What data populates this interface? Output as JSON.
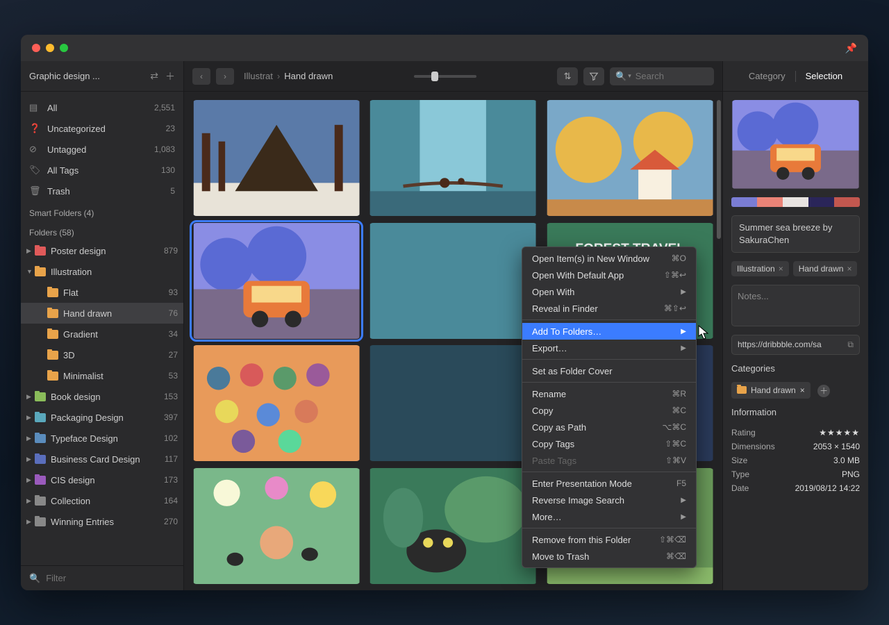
{
  "library_name": "Graphic design ...",
  "sidebar": {
    "all": {
      "label": "All",
      "count": "2,551"
    },
    "uncategorized": {
      "label": "Uncategorized",
      "count": "23"
    },
    "untagged": {
      "label": "Untagged",
      "count": "1,083"
    },
    "alltags": {
      "label": "All Tags",
      "count": "130"
    },
    "trash": {
      "label": "Trash",
      "count": "5"
    },
    "smart_label": "Smart Folders (4)",
    "folders_label": "Folders (58)",
    "folders": [
      {
        "label": "Poster design",
        "count": "879",
        "color": "#e05a5a",
        "depth": 0,
        "disc": "▶"
      },
      {
        "label": "Illustration",
        "count": "",
        "color": "#e8a34a",
        "depth": 0,
        "disc": "▼"
      },
      {
        "label": "Flat",
        "count": "93",
        "color": "#e8a34a",
        "depth": 1,
        "disc": ""
      },
      {
        "label": "Hand drawn",
        "count": "76",
        "color": "#e8a34a",
        "depth": 1,
        "disc": "",
        "active": true
      },
      {
        "label": "Gradient",
        "count": "34",
        "color": "#e8a34a",
        "depth": 1,
        "disc": ""
      },
      {
        "label": "3D",
        "count": "27",
        "color": "#e8a34a",
        "depth": 1,
        "disc": ""
      },
      {
        "label": "Minimalist",
        "count": "53",
        "color": "#e8a34a",
        "depth": 1,
        "disc": ""
      },
      {
        "label": "Book design",
        "count": "153",
        "color": "#8abc5a",
        "depth": 0,
        "disc": "▶"
      },
      {
        "label": "Packaging Design",
        "count": "397",
        "color": "#5aa8bc",
        "depth": 0,
        "disc": "▶"
      },
      {
        "label": "Typeface Design",
        "count": "102",
        "color": "#5a8cbc",
        "depth": 0,
        "disc": "▶"
      },
      {
        "label": "Business Card Design",
        "count": "117",
        "color": "#5a6ebc",
        "depth": 0,
        "disc": "▶"
      },
      {
        "label": "CIS design",
        "count": "173",
        "color": "#9a5abc",
        "depth": 0,
        "disc": "▶"
      },
      {
        "label": "Collection",
        "count": "164",
        "color": "#888",
        "depth": 0,
        "disc": "▶"
      },
      {
        "label": "Winning Entries",
        "count": "270",
        "color": "#888",
        "depth": 0,
        "disc": "▶"
      }
    ]
  },
  "filter_placeholder": "Filter",
  "breadcrumb": {
    "a": "Illustrat",
    "b": "Hand drawn"
  },
  "search_placeholder": "Search",
  "context_menu": [
    {
      "label": "Open Item(s) in New Window",
      "shortcut": "⌘O"
    },
    {
      "label": "Open With Default App",
      "shortcut": "⇧⌘↩"
    },
    {
      "label": "Open With",
      "sub": true
    },
    {
      "label": "Reveal in Finder",
      "shortcut": "⌘⇧↩"
    },
    {
      "sep": true
    },
    {
      "label": "Add To Folders…",
      "sub": true,
      "highlight": true
    },
    {
      "label": "Export…",
      "sub": true
    },
    {
      "sep": true
    },
    {
      "label": "Set as Folder Cover"
    },
    {
      "sep": true
    },
    {
      "label": "Rename",
      "shortcut": "⌘R"
    },
    {
      "label": "Copy",
      "shortcut": "⌘C"
    },
    {
      "label": "Copy as Path",
      "shortcut": "⌥⌘C"
    },
    {
      "label": "Copy Tags",
      "shortcut": "⇧⌘C"
    },
    {
      "label": "Paste Tags",
      "shortcut": "⇧⌘V",
      "disabled": true
    },
    {
      "sep": true
    },
    {
      "label": "Enter Presentation Mode",
      "shortcut": "F5"
    },
    {
      "label": "Reverse Image Search",
      "sub": true
    },
    {
      "label": "More…",
      "sub": true
    },
    {
      "sep": true
    },
    {
      "label": "Remove from this Folder",
      "shortcut": "⇧⌘⌫"
    },
    {
      "label": "Move to Trash",
      "shortcut": "⌘⌫"
    }
  ],
  "inspector": {
    "tab_category": "Category",
    "tab_selection": "Selection",
    "swatches": [
      "#7a7dd4",
      "#ea8377",
      "#e8e3e1",
      "#2a2559",
      "#c2574f"
    ],
    "item_name": "Summer sea breeze by SakuraChen",
    "tags": [
      "Illustration",
      "Hand drawn"
    ],
    "notes_placeholder": "Notes...",
    "url": "https://dribbble.com/sa",
    "categories_label": "Categories",
    "category_chip": "Hand drawn",
    "info_label": "Information",
    "rating": 5,
    "info": {
      "rating_label": "Rating",
      "dims_label": "Dimensions",
      "dims": "2053 × 1540",
      "size_label": "Size",
      "size": "3.0 MB",
      "type_label": "Type",
      "type": "PNG",
      "date_label": "Date",
      "date": "2019/08/12 14:22"
    }
  }
}
